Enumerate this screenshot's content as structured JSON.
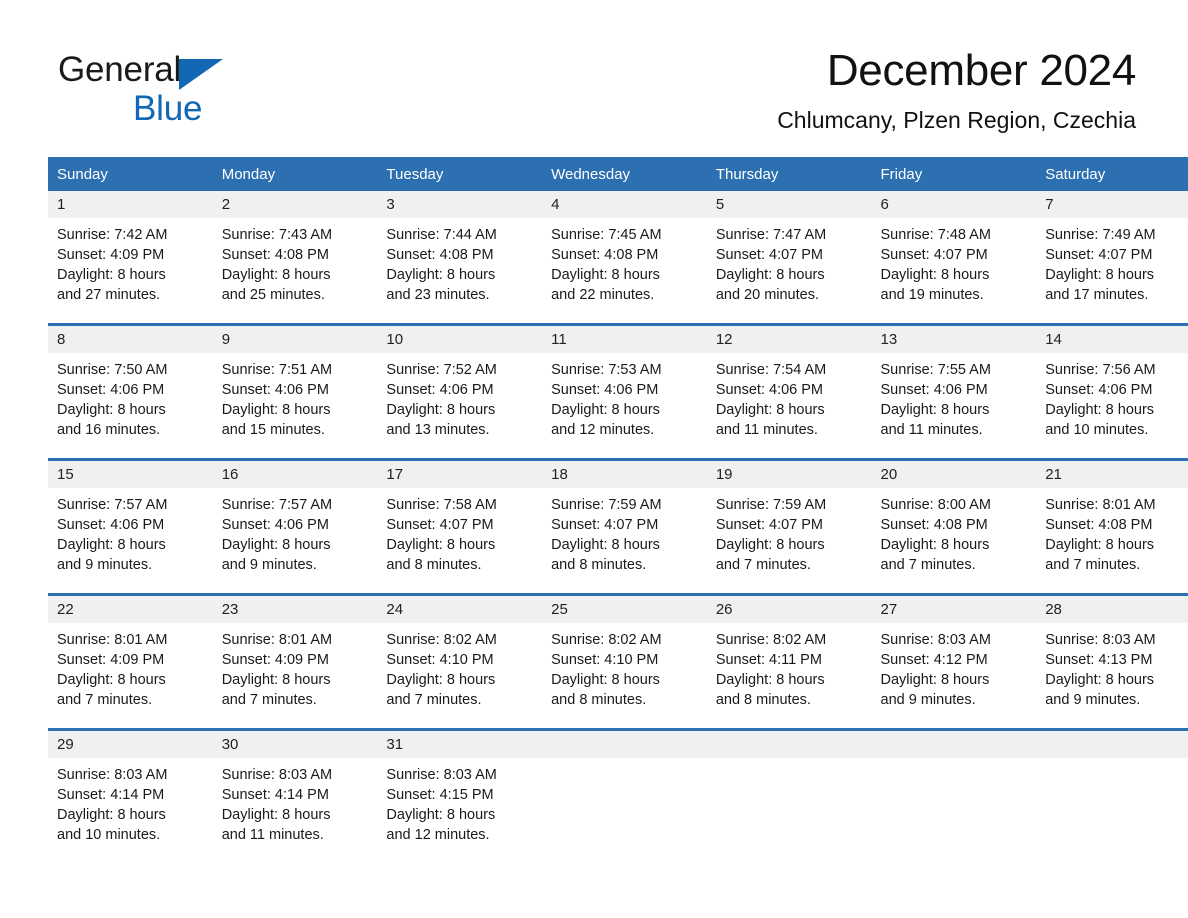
{
  "brand": {
    "word1": "General",
    "word2": "Blue",
    "triangle_color": "#1268b3"
  },
  "header": {
    "month_title": "December 2024",
    "location": "Chlumcany, Plzen Region, Czechia"
  },
  "theme": {
    "accent_blue": "#2c70b2",
    "daynum_band": "#f0f0f0",
    "text": "#1a1a1a"
  },
  "weekday_headers": [
    "Sunday",
    "Monday",
    "Tuesday",
    "Wednesday",
    "Thursday",
    "Friday",
    "Saturday"
  ],
  "weeks": [
    [
      {
        "day": "1",
        "sunrise": "Sunrise: 7:42 AM",
        "sunset": "Sunset: 4:09 PM",
        "daylight1": "Daylight: 8 hours",
        "daylight2": "and 27 minutes."
      },
      {
        "day": "2",
        "sunrise": "Sunrise: 7:43 AM",
        "sunset": "Sunset: 4:08 PM",
        "daylight1": "Daylight: 8 hours",
        "daylight2": "and 25 minutes."
      },
      {
        "day": "3",
        "sunrise": "Sunrise: 7:44 AM",
        "sunset": "Sunset: 4:08 PM",
        "daylight1": "Daylight: 8 hours",
        "daylight2": "and 23 minutes."
      },
      {
        "day": "4",
        "sunrise": "Sunrise: 7:45 AM",
        "sunset": "Sunset: 4:08 PM",
        "daylight1": "Daylight: 8 hours",
        "daylight2": "and 22 minutes."
      },
      {
        "day": "5",
        "sunrise": "Sunrise: 7:47 AM",
        "sunset": "Sunset: 4:07 PM",
        "daylight1": "Daylight: 8 hours",
        "daylight2": "and 20 minutes."
      },
      {
        "day": "6",
        "sunrise": "Sunrise: 7:48 AM",
        "sunset": "Sunset: 4:07 PM",
        "daylight1": "Daylight: 8 hours",
        "daylight2": "and 19 minutes."
      },
      {
        "day": "7",
        "sunrise": "Sunrise: 7:49 AM",
        "sunset": "Sunset: 4:07 PM",
        "daylight1": "Daylight: 8 hours",
        "daylight2": "and 17 minutes."
      }
    ],
    [
      {
        "day": "8",
        "sunrise": "Sunrise: 7:50 AM",
        "sunset": "Sunset: 4:06 PM",
        "daylight1": "Daylight: 8 hours",
        "daylight2": "and 16 minutes."
      },
      {
        "day": "9",
        "sunrise": "Sunrise: 7:51 AM",
        "sunset": "Sunset: 4:06 PM",
        "daylight1": "Daylight: 8 hours",
        "daylight2": "and 15 minutes."
      },
      {
        "day": "10",
        "sunrise": "Sunrise: 7:52 AM",
        "sunset": "Sunset: 4:06 PM",
        "daylight1": "Daylight: 8 hours",
        "daylight2": "and 13 minutes."
      },
      {
        "day": "11",
        "sunrise": "Sunrise: 7:53 AM",
        "sunset": "Sunset: 4:06 PM",
        "daylight1": "Daylight: 8 hours",
        "daylight2": "and 12 minutes."
      },
      {
        "day": "12",
        "sunrise": "Sunrise: 7:54 AM",
        "sunset": "Sunset: 4:06 PM",
        "daylight1": "Daylight: 8 hours",
        "daylight2": "and 11 minutes."
      },
      {
        "day": "13",
        "sunrise": "Sunrise: 7:55 AM",
        "sunset": "Sunset: 4:06 PM",
        "daylight1": "Daylight: 8 hours",
        "daylight2": "and 11 minutes."
      },
      {
        "day": "14",
        "sunrise": "Sunrise: 7:56 AM",
        "sunset": "Sunset: 4:06 PM",
        "daylight1": "Daylight: 8 hours",
        "daylight2": "and 10 minutes."
      }
    ],
    [
      {
        "day": "15",
        "sunrise": "Sunrise: 7:57 AM",
        "sunset": "Sunset: 4:06 PM",
        "daylight1": "Daylight: 8 hours",
        "daylight2": "and 9 minutes."
      },
      {
        "day": "16",
        "sunrise": "Sunrise: 7:57 AM",
        "sunset": "Sunset: 4:06 PM",
        "daylight1": "Daylight: 8 hours",
        "daylight2": "and 9 minutes."
      },
      {
        "day": "17",
        "sunrise": "Sunrise: 7:58 AM",
        "sunset": "Sunset: 4:07 PM",
        "daylight1": "Daylight: 8 hours",
        "daylight2": "and 8 minutes."
      },
      {
        "day": "18",
        "sunrise": "Sunrise: 7:59 AM",
        "sunset": "Sunset: 4:07 PM",
        "daylight1": "Daylight: 8 hours",
        "daylight2": "and 8 minutes."
      },
      {
        "day": "19",
        "sunrise": "Sunrise: 7:59 AM",
        "sunset": "Sunset: 4:07 PM",
        "daylight1": "Daylight: 8 hours",
        "daylight2": "and 7 minutes."
      },
      {
        "day": "20",
        "sunrise": "Sunrise: 8:00 AM",
        "sunset": "Sunset: 4:08 PM",
        "daylight1": "Daylight: 8 hours",
        "daylight2": "and 7 minutes."
      },
      {
        "day": "21",
        "sunrise": "Sunrise: 8:01 AM",
        "sunset": "Sunset: 4:08 PM",
        "daylight1": "Daylight: 8 hours",
        "daylight2": "and 7 minutes."
      }
    ],
    [
      {
        "day": "22",
        "sunrise": "Sunrise: 8:01 AM",
        "sunset": "Sunset: 4:09 PM",
        "daylight1": "Daylight: 8 hours",
        "daylight2": "and 7 minutes."
      },
      {
        "day": "23",
        "sunrise": "Sunrise: 8:01 AM",
        "sunset": "Sunset: 4:09 PM",
        "daylight1": "Daylight: 8 hours",
        "daylight2": "and 7 minutes."
      },
      {
        "day": "24",
        "sunrise": "Sunrise: 8:02 AM",
        "sunset": "Sunset: 4:10 PM",
        "daylight1": "Daylight: 8 hours",
        "daylight2": "and 7 minutes."
      },
      {
        "day": "25",
        "sunrise": "Sunrise: 8:02 AM",
        "sunset": "Sunset: 4:10 PM",
        "daylight1": "Daylight: 8 hours",
        "daylight2": "and 8 minutes."
      },
      {
        "day": "26",
        "sunrise": "Sunrise: 8:02 AM",
        "sunset": "Sunset: 4:11 PM",
        "daylight1": "Daylight: 8 hours",
        "daylight2": "and 8 minutes."
      },
      {
        "day": "27",
        "sunrise": "Sunrise: 8:03 AM",
        "sunset": "Sunset: 4:12 PM",
        "daylight1": "Daylight: 8 hours",
        "daylight2": "and 9 minutes."
      },
      {
        "day": "28",
        "sunrise": "Sunrise: 8:03 AM",
        "sunset": "Sunset: 4:13 PM",
        "daylight1": "Daylight: 8 hours",
        "daylight2": "and 9 minutes."
      }
    ],
    [
      {
        "day": "29",
        "sunrise": "Sunrise: 8:03 AM",
        "sunset": "Sunset: 4:14 PM",
        "daylight1": "Daylight: 8 hours",
        "daylight2": "and 10 minutes."
      },
      {
        "day": "30",
        "sunrise": "Sunrise: 8:03 AM",
        "sunset": "Sunset: 4:14 PM",
        "daylight1": "Daylight: 8 hours",
        "daylight2": "and 11 minutes."
      },
      {
        "day": "31",
        "sunrise": "Sunrise: 8:03 AM",
        "sunset": "Sunset: 4:15 PM",
        "daylight1": "Daylight: 8 hours",
        "daylight2": "and 12 minutes."
      },
      {
        "day": "",
        "sunrise": "",
        "sunset": "",
        "daylight1": "",
        "daylight2": ""
      },
      {
        "day": "",
        "sunrise": "",
        "sunset": "",
        "daylight1": "",
        "daylight2": ""
      },
      {
        "day": "",
        "sunrise": "",
        "sunset": "",
        "daylight1": "",
        "daylight2": ""
      },
      {
        "day": "",
        "sunrise": "",
        "sunset": "",
        "daylight1": "",
        "daylight2": ""
      }
    ]
  ]
}
